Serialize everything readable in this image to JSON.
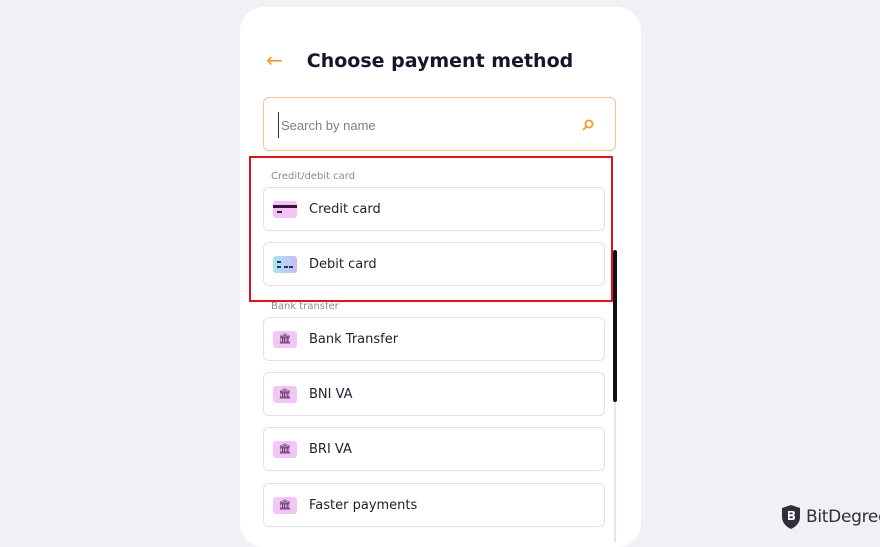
{
  "header": {
    "back_icon": "←",
    "title": "Choose payment method"
  },
  "search": {
    "placeholder": "Search by name",
    "value": "",
    "icon": "search-icon"
  },
  "sections": [
    {
      "label": "Credit/debit card",
      "items": [
        {
          "label": "Credit card",
          "icon": "credit-card-icon"
        },
        {
          "label": "Debit card",
          "icon": "debit-card-icon"
        }
      ]
    },
    {
      "label": "Bank transfer",
      "items": [
        {
          "label": "Bank Transfer",
          "icon": "bank-icon"
        },
        {
          "label": "BNI VA",
          "icon": "bank-icon"
        },
        {
          "label": "BRI VA",
          "icon": "bank-icon"
        },
        {
          "label": "Faster payments",
          "icon": "bank-icon"
        }
      ]
    }
  ],
  "colors": {
    "accent": "#f39a2b",
    "highlight": "#e0141e",
    "background": "#f0f1f5"
  },
  "watermark": {
    "brand": "BitDegree"
  }
}
